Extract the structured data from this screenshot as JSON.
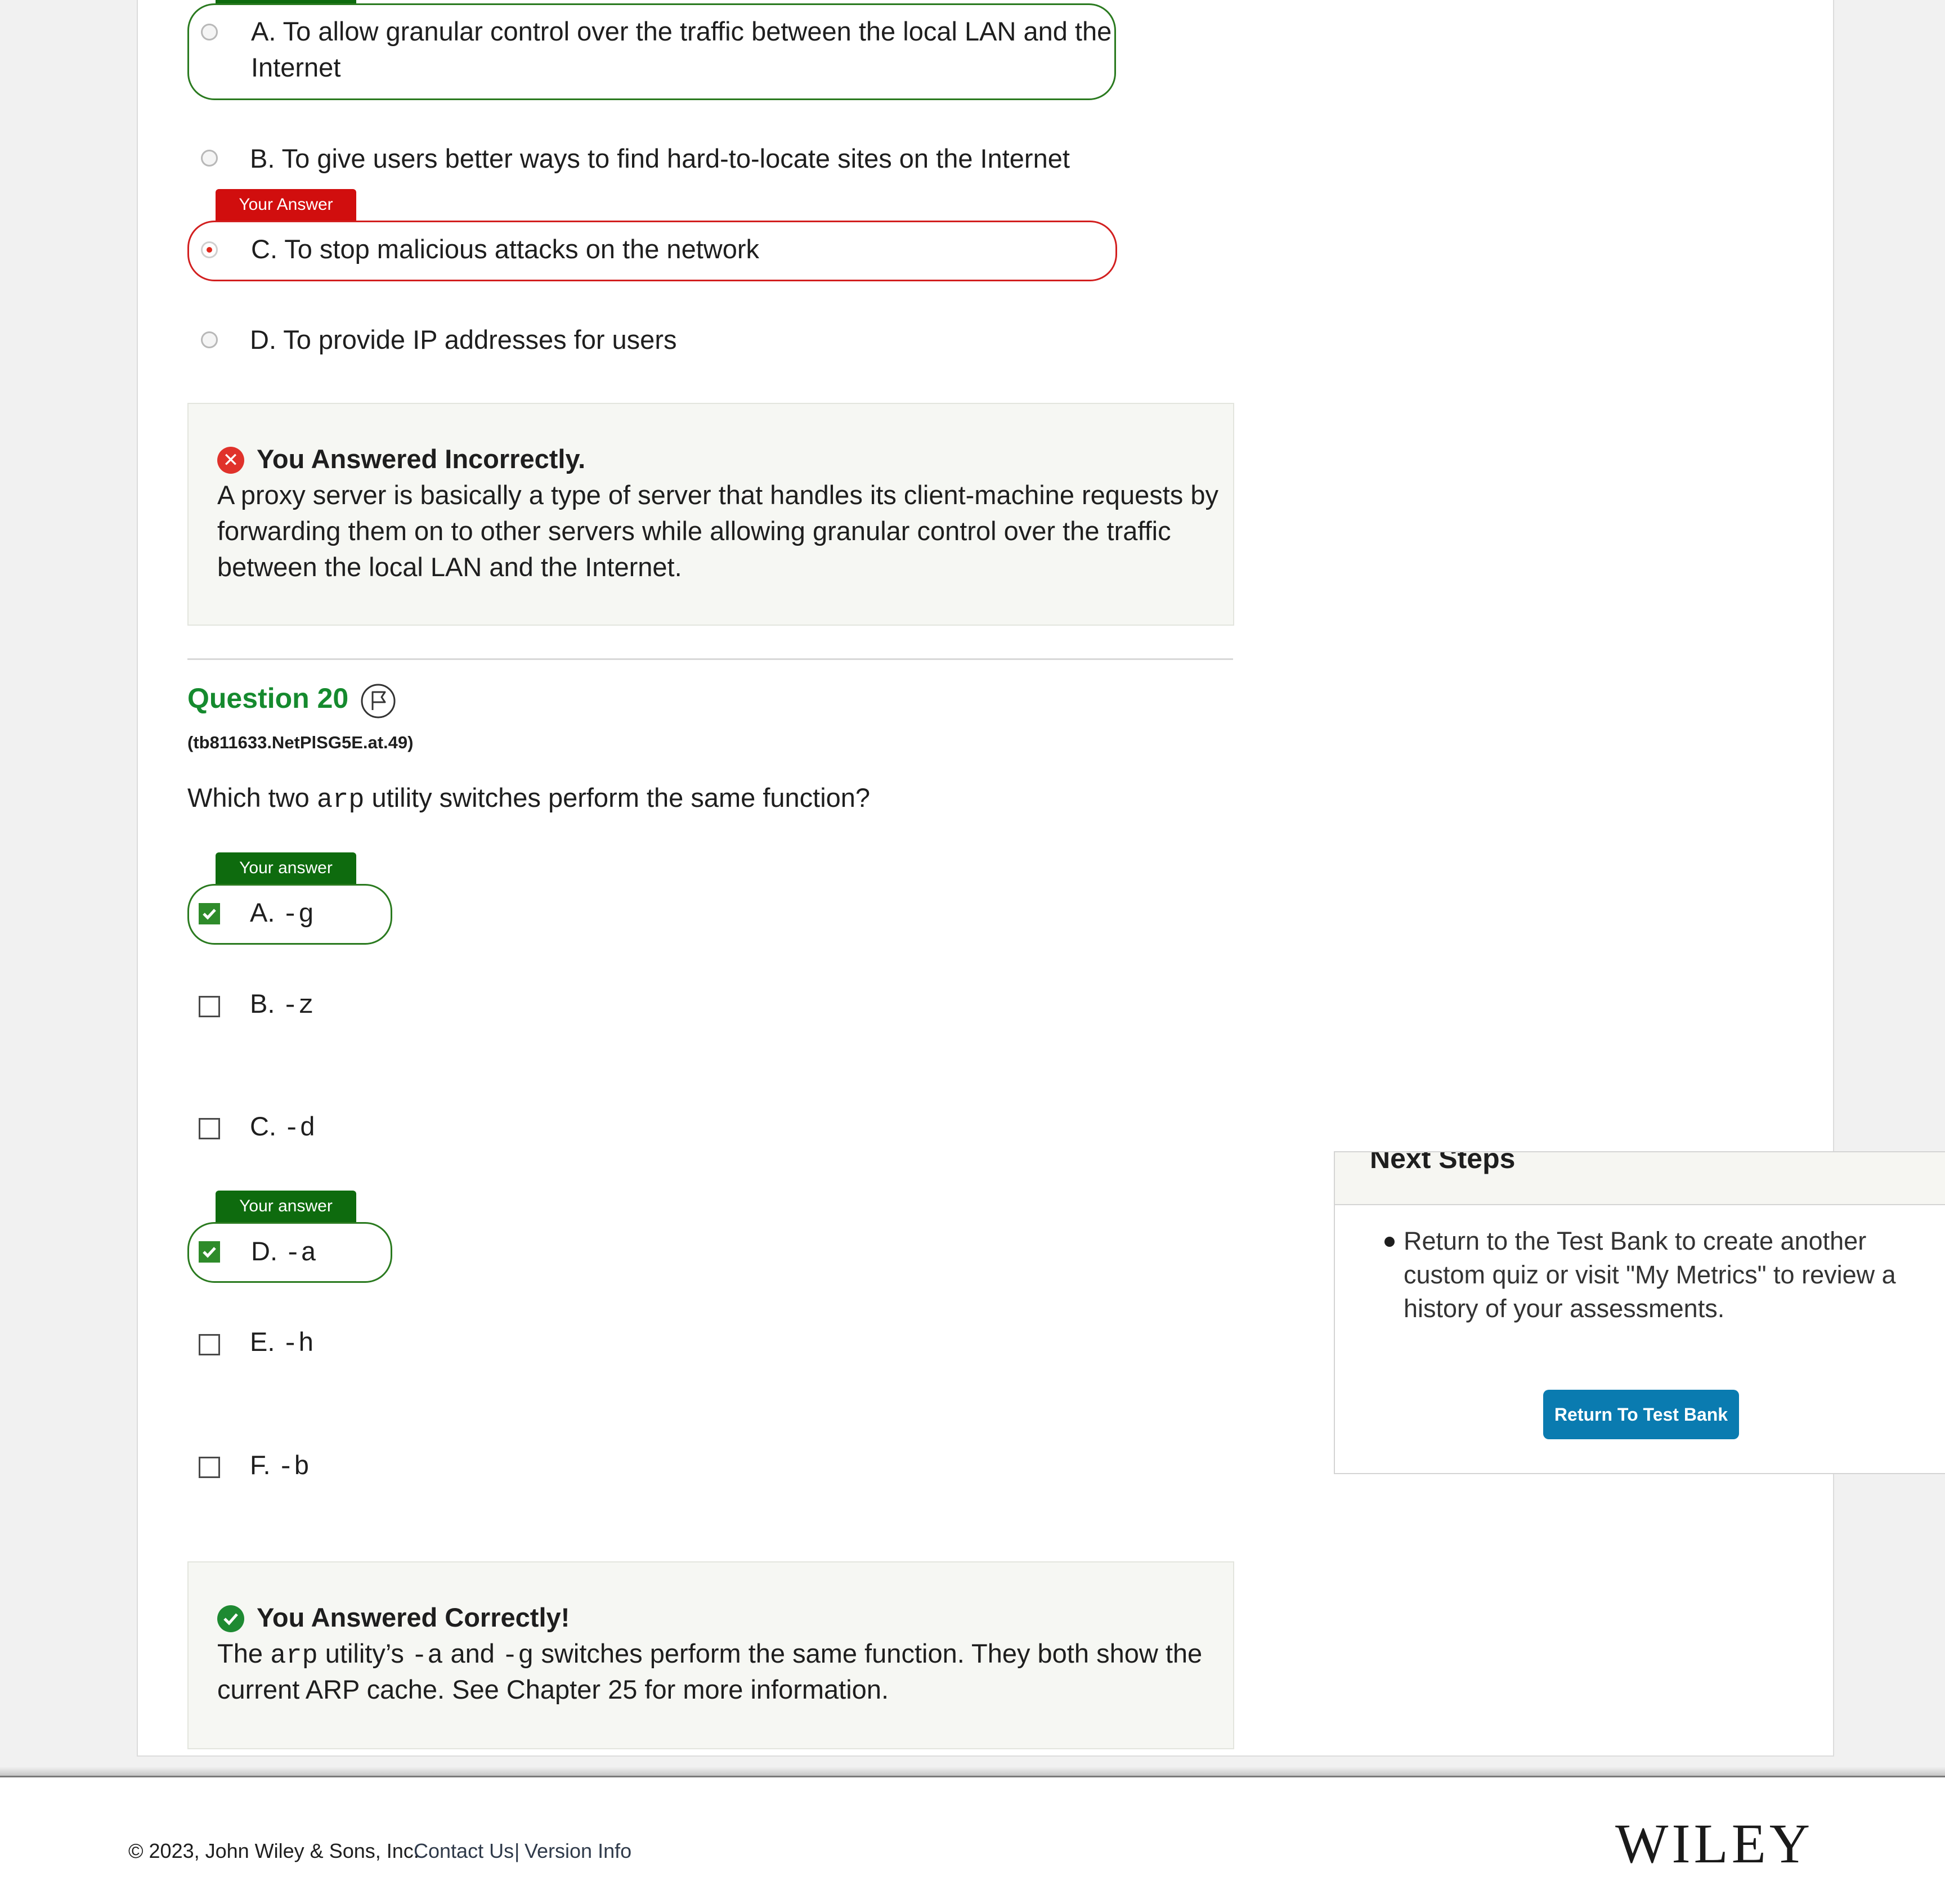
{
  "q19": {
    "options": [
      {
        "text": "A. To allow granular control over the traffic between the local LAN and the",
        "text2": "Internet"
      },
      {
        "text": "B. To give users better ways to find hard-to-locate sites on the Internet"
      },
      {
        "text": "C. To stop malicious attacks on the network",
        "tag": "Your Answer"
      },
      {
        "text": "D. To provide IP addresses for users"
      }
    ],
    "feedback": {
      "title": "You Answered Incorrectly.",
      "lines": [
        "A proxy server is basically a type of server that handles its client-machine requests by",
        "forwarding them on to other servers while allowing granular control over the traffic",
        "between the local LAN and the Internet."
      ]
    }
  },
  "q20": {
    "title": "Question 20",
    "id": "(tb811633.NetPlSG5E.at.49)",
    "text_before": "Which two",
    "text_code": "arp",
    "text_after": "utility switches perform the same function?",
    "options": [
      {
        "letter": "A.",
        "code": "-g",
        "tag": "Your answer"
      },
      {
        "letter": "B.",
        "code": "-z"
      },
      {
        "letter": "C.",
        "code": "-d"
      },
      {
        "letter": "D.",
        "code": "-a",
        "tag": "Your answer"
      },
      {
        "letter": "E.",
        "code": "-h"
      },
      {
        "letter": "F.",
        "code": "-b"
      }
    ],
    "feedback": {
      "title": "You Answered Correctly!",
      "p1": "The",
      "c1": "arp",
      "p2": "utility’s",
      "c2": "-a",
      "p3": "and",
      "c3": "-g",
      "p4": "switches perform the same function. They both show the",
      "line2": "current ARP cache. See Chapter 25 for more information."
    }
  },
  "next_steps": {
    "title": "Next Steps",
    "text": "Return to the Test Bank to create another custom quiz or visit \"My Metrics\" to review a history of your assessments.",
    "button": "Return To Test Bank"
  },
  "footer": {
    "copyright": "© 2023, John Wiley & Sons, Inc.",
    "contact": "Contact Us",
    "separator": "|",
    "version": "Version Info",
    "logo": "WILEY"
  },
  "colors": {
    "correct_green": "#158a2e",
    "answer_tag_green": "#0e6b0e",
    "your_answer_red": "#d10e0e",
    "button_blue": "#0a7bb0"
  }
}
